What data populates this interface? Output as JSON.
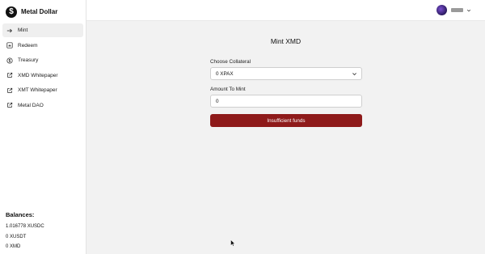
{
  "brand": {
    "name": "Metal Dollar",
    "logo_glyph": "$"
  },
  "sidebar": {
    "items": [
      {
        "label": "Mint",
        "icon": "arrow-right-icon",
        "active": true
      },
      {
        "label": "Redeem",
        "icon": "redeem-icon",
        "active": false
      },
      {
        "label": "Treasury",
        "icon": "dollar-circle-icon",
        "active": false
      },
      {
        "label": "XMD Whitepaper",
        "icon": "external-link-icon",
        "active": false
      },
      {
        "label": "XMT Whitepaper",
        "icon": "external-link-icon",
        "active": false
      },
      {
        "label": "Metal DAO",
        "icon": "external-link-icon",
        "active": false
      }
    ]
  },
  "balances": {
    "title": "Balances:",
    "items": [
      "1.016778 XUSDC",
      "0 XUSDT",
      "0 XMD"
    ]
  },
  "header": {
    "account_chevron_icon": "chevron-down-icon"
  },
  "main": {
    "title": "Mint XMD",
    "collateral": {
      "label": "Choose Collateral",
      "value": "0 XPAX"
    },
    "amount": {
      "label": "Amount To Mint",
      "value": "0"
    },
    "submit_label": "Insufficient funds"
  },
  "colors": {
    "submit_bg": "#8e1a1a",
    "main_bg": "#f2f2f2",
    "active_nav_bg": "#efefef"
  }
}
